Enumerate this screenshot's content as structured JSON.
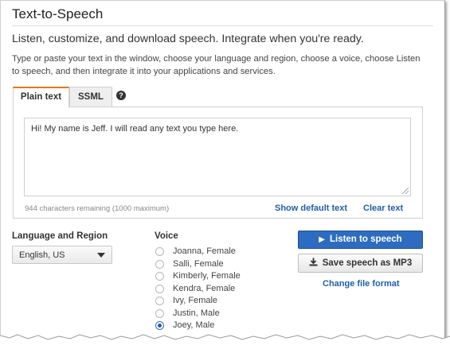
{
  "page": {
    "title": "Text-to-Speech",
    "subtitle": "Listen, customize, and download speech. Integrate when you're ready.",
    "description": "Type or paste your text in the window, choose your language and region, choose a voice, choose Listen to speech, and then integrate it into your applications and services."
  },
  "tabs": [
    {
      "label": "Plain text",
      "active": true
    },
    {
      "label": "SSML",
      "active": false
    }
  ],
  "help_icon": {
    "glyph": "?",
    "icon": "help-icon"
  },
  "editor": {
    "value": "Hi! My name is Jeff. I will read any text you type here.",
    "remaining": "944 characters remaining (1000 maximum)",
    "show_default_label": "Show default text",
    "clear_label": "Clear text"
  },
  "language": {
    "label": "Language and Region",
    "selected": "English, US"
  },
  "voice": {
    "label": "Voice",
    "options": [
      {
        "label": "Joanna, Female",
        "selected": false
      },
      {
        "label": "Salli, Female",
        "selected": false
      },
      {
        "label": "Kimberly, Female",
        "selected": false
      },
      {
        "label": "Kendra, Female",
        "selected": false
      },
      {
        "label": "Ivy, Female",
        "selected": false
      },
      {
        "label": "Justin, Male",
        "selected": false
      },
      {
        "label": "Joey, Male",
        "selected": true
      }
    ]
  },
  "actions": {
    "listen_label": "Listen to speech",
    "listen_icon": "play-icon",
    "save_label": "Save speech as MP3",
    "save_icon": "download-icon",
    "change_format_label": "Change file format"
  },
  "colors": {
    "accent_tab": "#e47911",
    "primary_button": "#2d6cc0",
    "link": "#1f5fa8"
  }
}
